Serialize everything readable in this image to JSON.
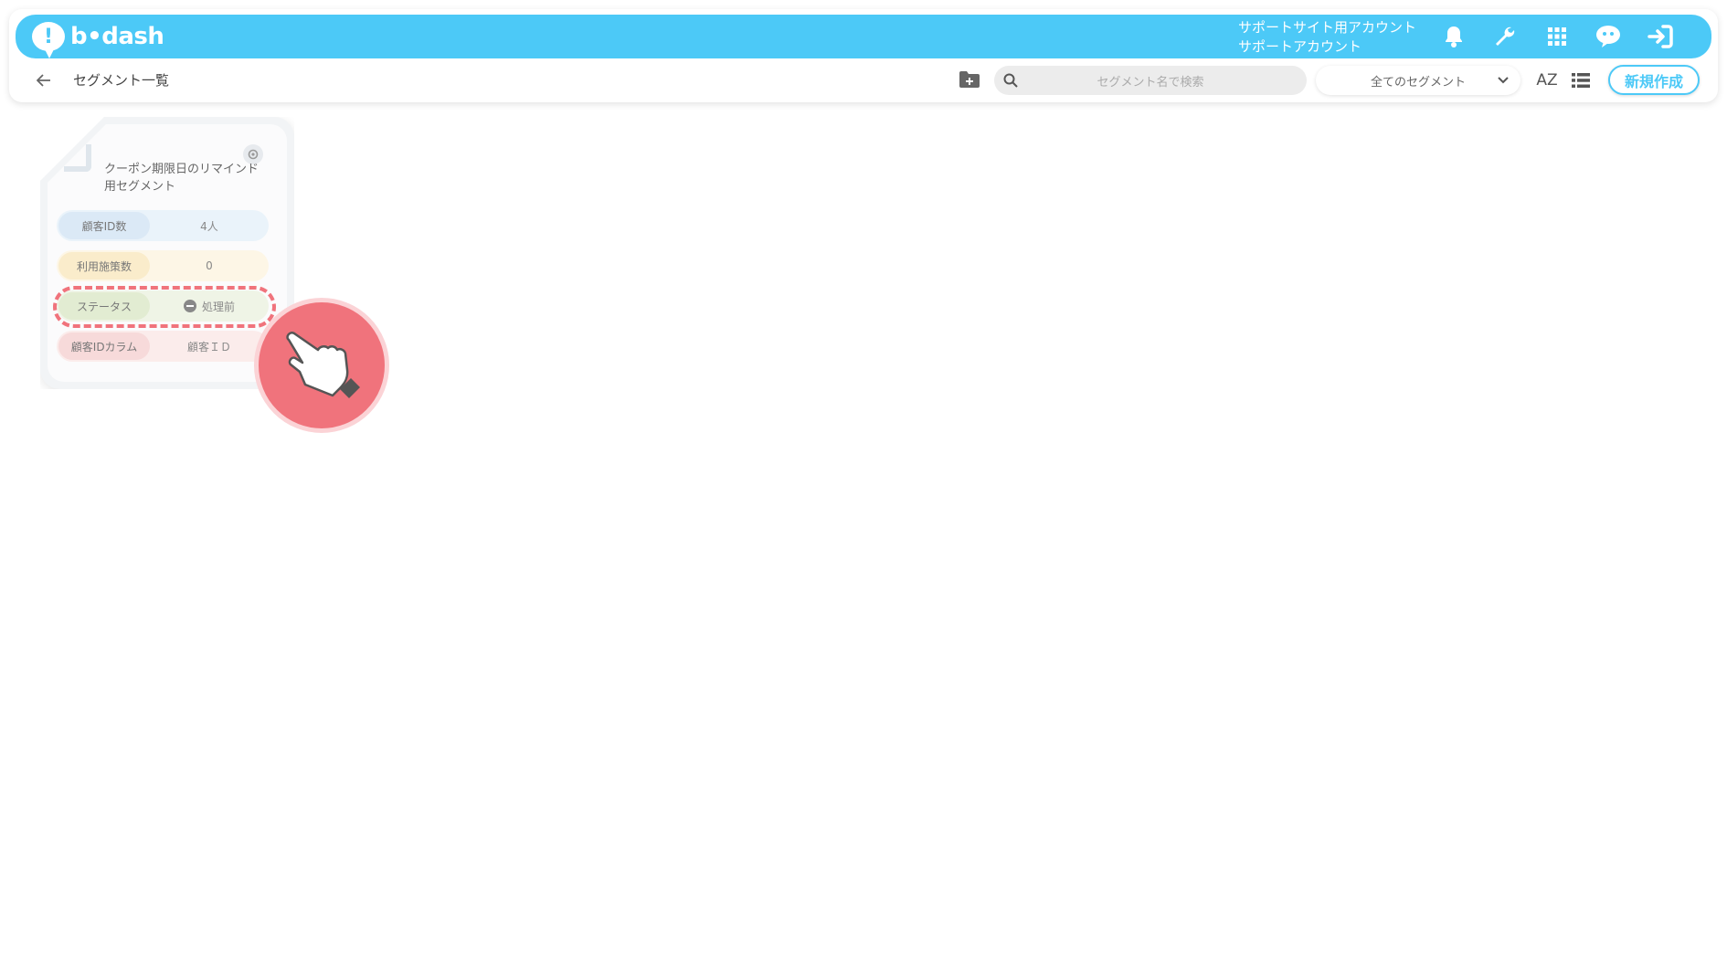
{
  "app": {
    "logo_text": "b•dash",
    "account_line1": "サポートサイト用アカウント",
    "account_line2": "サポートアカウント"
  },
  "topbar": {
    "icons": [
      "bell-icon",
      "wrench-icon",
      "apps-grid-icon",
      "chat-bot-icon",
      "logout-icon"
    ]
  },
  "subbar": {
    "title": "セグメント一覧",
    "search_placeholder": "セグメント名で検索",
    "filter_selected": "全てのセグメント",
    "sort_label": "AZ",
    "new_button": "新規作成"
  },
  "cards": [
    {
      "title": "クーポン期限日のリマインド用セグメント",
      "rows": [
        {
          "label": "顧客ID数",
          "value": "4人"
        },
        {
          "label": "利用施策数",
          "value": "0"
        },
        {
          "label": "ステータス",
          "value": "処理前"
        },
        {
          "label": "顧客IDカラム",
          "value": "顧客ＩＤ"
        }
      ]
    }
  ],
  "colors": {
    "brand": "#4cc9f7",
    "highlight": "#f0737c"
  }
}
